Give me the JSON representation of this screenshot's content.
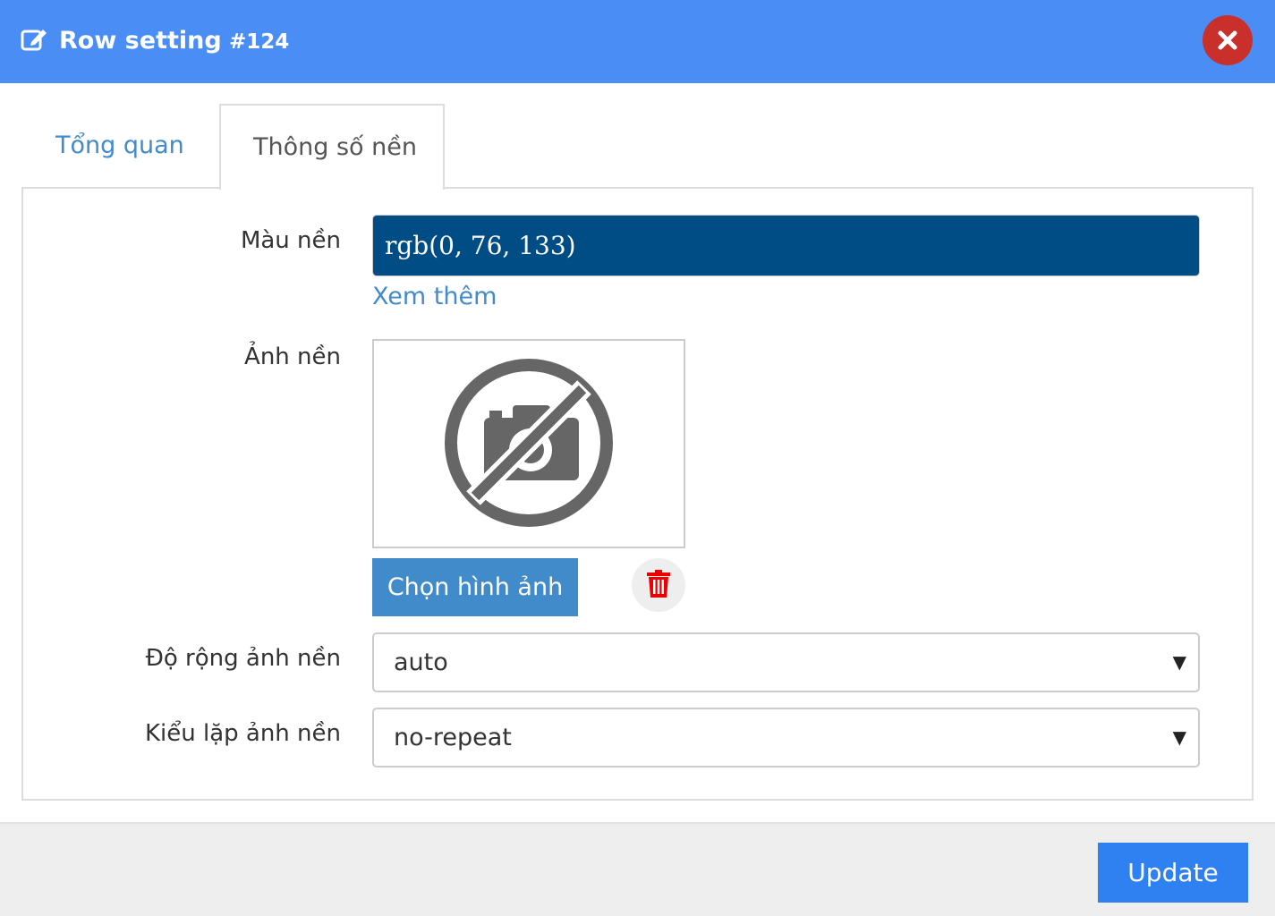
{
  "header": {
    "title": "Row setting",
    "row_id": "#124",
    "icon": "edit-icon",
    "close_icon": "close-icon",
    "background_color": "#4a8ef5",
    "close_color": "#c9302c"
  },
  "tabs": [
    {
      "label": "Tổng quan",
      "active": false
    },
    {
      "label": "Thông số nền",
      "active": true
    }
  ],
  "form": {
    "background_color": {
      "label": "Màu nền",
      "value": "rgb(0, 76, 133)",
      "swatch": "#004c85",
      "more_link": "Xem thêm"
    },
    "background_image": {
      "label": "Ảnh nền",
      "placeholder_icon": "no-camera-icon",
      "choose_button": "Chọn hình ảnh",
      "delete_icon": "trash-icon"
    },
    "background_size": {
      "label": "Độ rộng ảnh nền",
      "value": "auto"
    },
    "background_repeat": {
      "label": "Kiểu lặp ảnh nền",
      "value": "no-repeat"
    },
    "dropdown_arrow": "▼"
  },
  "footer": {
    "update_button": "Update",
    "update_color": "#2f80f0"
  }
}
